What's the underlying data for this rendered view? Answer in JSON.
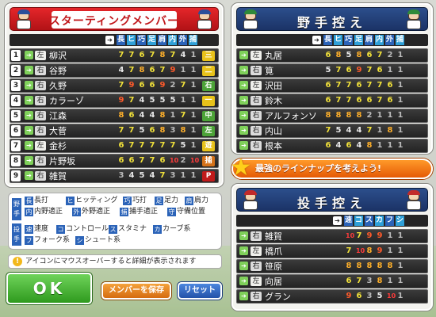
{
  "starting": {
    "title": "スターティングメンバー",
    "headers": [
      "長",
      "ヒ",
      "巧",
      "足",
      "肩",
      "内",
      "外",
      "捕"
    ],
    "players": [
      {
        "no": "1",
        "hand": "左",
        "name": "柳沢",
        "ranks": [
          "7",
          "7",
          "6",
          "7",
          "8",
          "7",
          "4",
          "1"
        ],
        "pos": "三",
        "pos_color": "#e8c21a"
      },
      {
        "no": "2",
        "hand": "右",
        "name": "谷野",
        "ranks": [
          "4",
          "7",
          "8",
          "6",
          "7",
          "9",
          "1",
          "1"
        ],
        "pos": "二",
        "pos_color": "#e8c21a"
      },
      {
        "no": "3",
        "hand": "右",
        "name": "久野",
        "ranks": [
          "7",
          "9",
          "6",
          "6",
          "9",
          "2",
          "7",
          "1"
        ],
        "pos": "右",
        "pos_color": "#4ca338"
      },
      {
        "no": "4",
        "hand": "右",
        "name": "カラーゾ",
        "ranks": [
          "9",
          "7",
          "4",
          "5",
          "5",
          "5",
          "1",
          "1"
        ],
        "pos": "一",
        "pos_color": "#e8c21a"
      },
      {
        "no": "5",
        "hand": "右",
        "name": "江森",
        "ranks": [
          "8",
          "6",
          "4",
          "4",
          "8",
          "1",
          "7",
          "1"
        ],
        "pos": "中",
        "pos_color": "#4ca338"
      },
      {
        "no": "6",
        "hand": "右",
        "name": "大菅",
        "ranks": [
          "7",
          "7",
          "5",
          "6",
          "8",
          "3",
          "8",
          "1"
        ],
        "pos": "左",
        "pos_color": "#4ca338"
      },
      {
        "no": "7",
        "hand": "左",
        "name": "金杉",
        "ranks": [
          "6",
          "7",
          "7",
          "7",
          "7",
          "7",
          "5",
          "1"
        ],
        "pos": "遊",
        "pos_color": "#e8c21a"
      },
      {
        "no": "8",
        "hand": "右",
        "name": "片野坂",
        "ranks": [
          "6",
          "6",
          "7",
          "7",
          "6",
          "10",
          "2",
          "10"
        ],
        "pos": "捕",
        "pos_color": "#d4721a"
      },
      {
        "no": "9",
        "hand": "右",
        "name": "雑賀",
        "ranks": [
          "3",
          "4",
          "5",
          "4",
          "7",
          "3",
          "1",
          "1"
        ],
        "pos": "P",
        "pos_color": "#c01a1a"
      }
    ]
  },
  "bench": {
    "title": "野手控え",
    "headers": [
      "長",
      "ヒ",
      "巧",
      "足",
      "肩",
      "内",
      "外",
      "捕"
    ],
    "players": [
      {
        "hand": "左",
        "name": "丸居",
        "ranks": [
          "6",
          "8",
          "5",
          "8",
          "6",
          "7",
          "2",
          "1"
        ]
      },
      {
        "hand": "右",
        "name": "筧",
        "ranks": [
          "5",
          "7",
          "6",
          "9",
          "7",
          "6",
          "1",
          "1"
        ]
      },
      {
        "hand": "左",
        "name": "沢田",
        "ranks": [
          "6",
          "7",
          "7",
          "6",
          "7",
          "7",
          "6",
          "1"
        ]
      },
      {
        "hand": "右",
        "name": "鈴木",
        "ranks": [
          "6",
          "7",
          "7",
          "6",
          "6",
          "7",
          "6",
          "1"
        ]
      },
      {
        "hand": "右",
        "name": "アルフォンソ",
        "ranks": [
          "8",
          "8",
          "8",
          "8",
          "2",
          "1",
          "1",
          "1"
        ]
      },
      {
        "hand": "右",
        "name": "内山",
        "ranks": [
          "7",
          "5",
          "4",
          "4",
          "7",
          "1",
          "8",
          "1"
        ]
      },
      {
        "hand": "右",
        "name": "根本",
        "ranks": [
          "6",
          "4",
          "6",
          "4",
          "8",
          "1",
          "1",
          "1"
        ]
      }
    ]
  },
  "pitchers": {
    "title": "投手控え",
    "headers": [
      "速",
      "コ",
      "ス",
      "カ",
      "フ",
      "シ"
    ],
    "players": [
      {
        "hand": "右",
        "name": "雑賀",
        "ranks": [
          "10",
          "7",
          "9",
          "9",
          "1",
          "1"
        ]
      },
      {
        "hand": "左",
        "name": "橋爪",
        "ranks": [
          "7",
          "10",
          "8",
          "9",
          "1",
          "1"
        ]
      },
      {
        "hand": "右",
        "name": "笹原",
        "ranks": [
          "8",
          "8",
          "8",
          "8",
          "8",
          "1"
        ]
      },
      {
        "hand": "左",
        "name": "向居",
        "ranks": [
          "6",
          "7",
          "3",
          "8",
          "1",
          "1"
        ]
      },
      {
        "hand": "右",
        "name": "グラン",
        "ranks": [
          "9",
          "6",
          "3",
          "5",
          "10",
          "1"
        ]
      }
    ]
  },
  "banner": "最強のラインナップを考えよう!",
  "legend": {
    "fielder_tag": "野手",
    "pitcher_tag": "投手",
    "fielder_items": [
      {
        "key": "長",
        "label": "長打"
      },
      {
        "key": "ヒ",
        "label": "ヒッティング"
      },
      {
        "key": "巧",
        "label": "巧打"
      },
      {
        "key": "足",
        "label": "足力"
      },
      {
        "key": "肩",
        "label": "肩力"
      },
      {
        "key": "内",
        "label": "内野適正"
      },
      {
        "key": "外",
        "label": "外野適正"
      },
      {
        "key": "捕",
        "label": "捕手適正"
      },
      {
        "key": "守",
        "label": "守備位置"
      }
    ],
    "pitcher_items": [
      {
        "key": "速",
        "label": "速度"
      },
      {
        "key": "コ",
        "label": "コントロール"
      },
      {
        "key": "ス",
        "label": "スタミナ"
      },
      {
        "key": "カ",
        "label": "カーブ系"
      },
      {
        "key": "フ",
        "label": "フォーク系"
      },
      {
        "key": "シ",
        "label": "シュート系"
      }
    ]
  },
  "hint": "アイコンにマウスオーバーすると詳細が表示されます",
  "buttons": {
    "ok": "OK",
    "save": "メンバーを保存",
    "reset": "リセット"
  }
}
